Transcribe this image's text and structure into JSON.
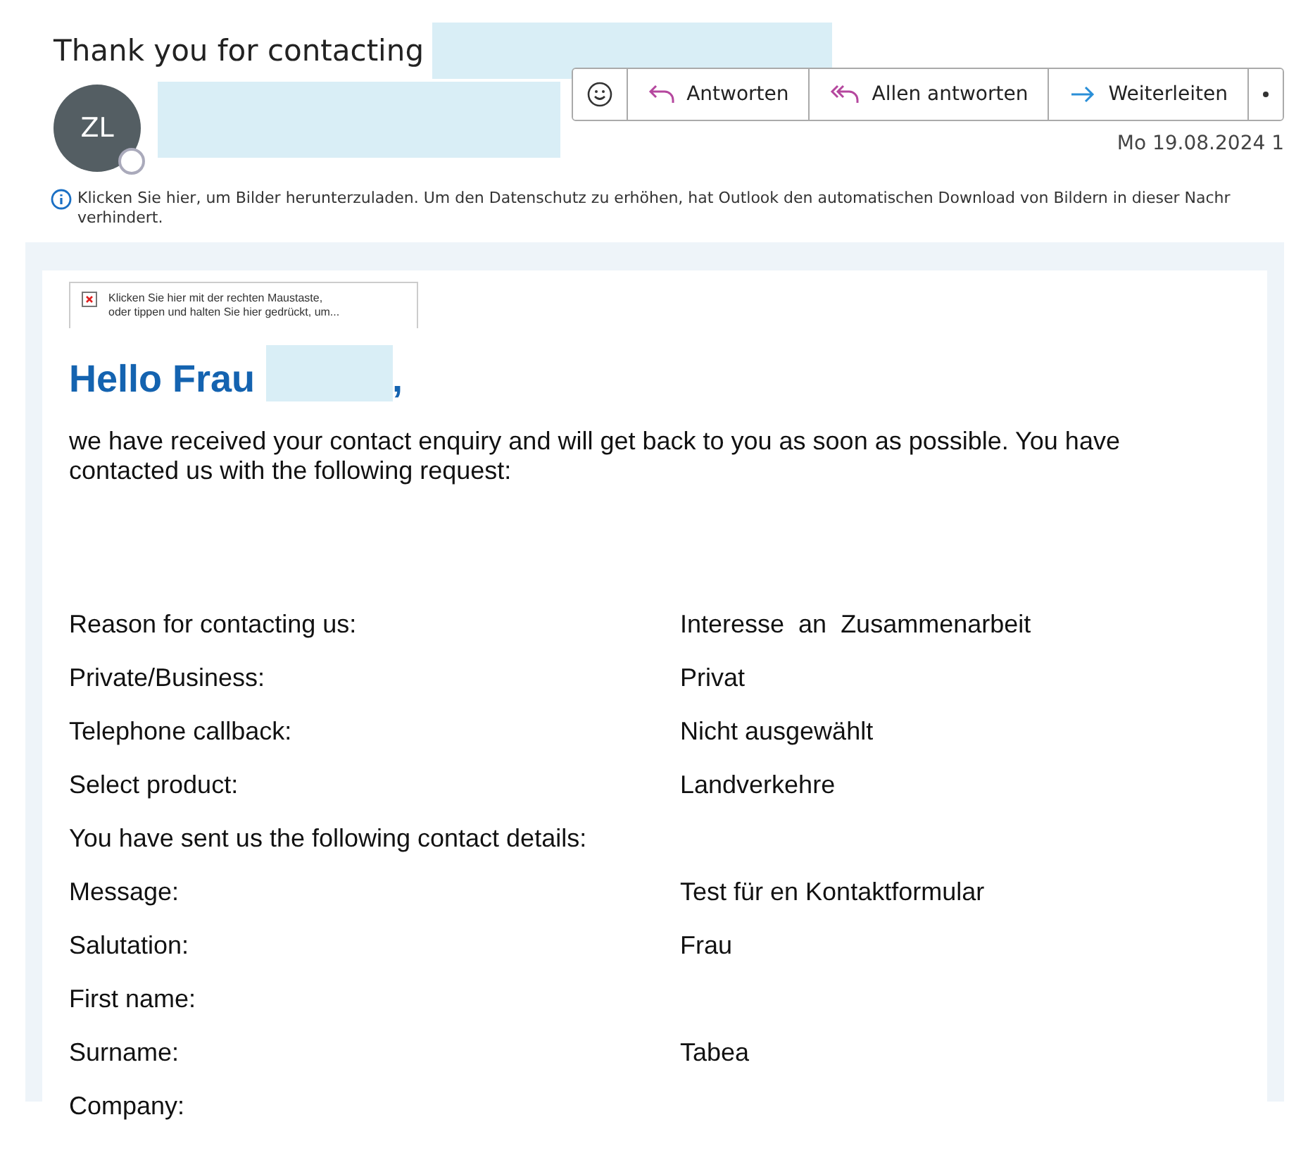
{
  "subject": "Thank you for contacting",
  "sender": {
    "initials": "ZL"
  },
  "actions": [
    {
      "kind": "emoji"
    },
    {
      "kind": "reply",
      "label": "Antworten"
    },
    {
      "kind": "reply_all",
      "label": "Allen antworten"
    },
    {
      "kind": "forward",
      "label": "Weiterleiten"
    },
    {
      "kind": "more"
    }
  ],
  "date": "Mo 19.08.2024 1",
  "info": "Klicken Sie hier, um Bilder herunterzuladen. Um den Datenschutz zu erhöhen, hat Outlook den automatischen Download von Bildern in dieser Nachr",
  "info_line2": "verhindert.",
  "image_placeholder": [
    "Klicken Sie hier mit der rechten Maustaste,",
    "oder tippen und halten Sie hier gedrückt, um..."
  ],
  "greeting": "Hello Frau",
  "greeting_end": ",",
  "intro": "we have received your contact enquiry and will get back to you as soon as possible. You have contacted us with the following request:",
  "rows": [
    {
      "label": "Reason for contacting us:",
      "value": "Interesse  an  Zusammenarbeit"
    },
    {
      "label": "Private/Business:",
      "value": "Privat"
    },
    {
      "label": "Telephone callback:",
      "value": "Nicht ausgewählt"
    },
    {
      "label": "Select product:",
      "value": "Landverkehre"
    },
    {
      "label": "You have sent us the following contact details:"
    },
    {
      "label": "Message:",
      "value": "Test für en Kontaktformular"
    },
    {
      "label": "Salutation:",
      "value": "Frau"
    },
    {
      "label": "First name:"
    },
    {
      "label": "Surname:",
      "value": "Tabea"
    },
    {
      "label": "Company:"
    }
  ]
}
